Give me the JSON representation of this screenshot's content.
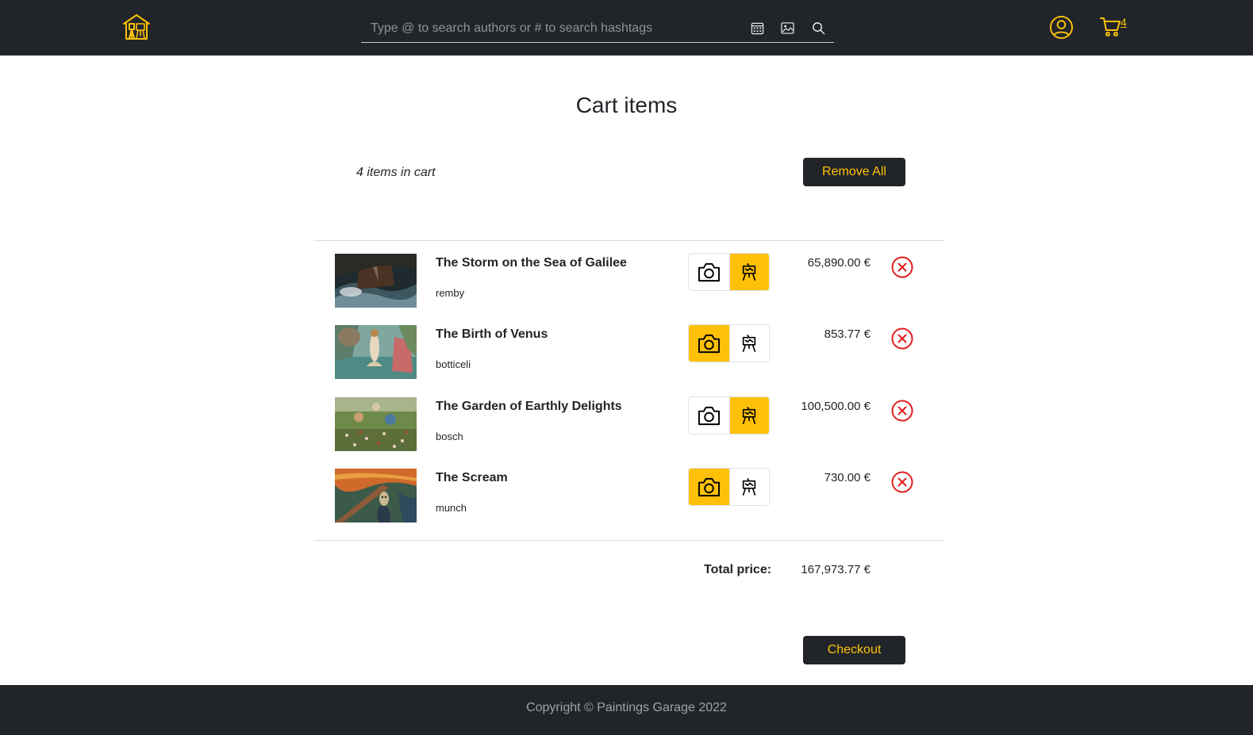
{
  "colors": {
    "navbar": "#212529",
    "accent": "#ffc107",
    "remove": "#e01e1e"
  },
  "header": {
    "logo_icon": "house-with-easel-icon",
    "search_placeholder": "Type @ to search authors or # to search hashtags",
    "search_buttons": [
      "calendar-icon",
      "image-icon",
      "search-icon"
    ],
    "user_icon": "user-circle-icon",
    "cart_icon": "cart-icon",
    "cart_count": "4"
  },
  "main": {
    "title": "Cart items",
    "items_count_text": "4 items in cart",
    "remove_all_label": "Remove All",
    "items": [
      {
        "title": "The Storm on the Sea of Galilee",
        "author": "remby",
        "price": "65,890.00 €",
        "selected_format": "canvas"
      },
      {
        "title": "The Birth of Venus",
        "author": "botticeli",
        "price": "853.77 €",
        "selected_format": "photo"
      },
      {
        "title": "The Garden of Earthly Delights",
        "author": "bosch",
        "price": "100,500.00 €",
        "selected_format": "canvas"
      },
      {
        "title": "The Scream",
        "author": "munch",
        "price": "730.00 €",
        "selected_format": "photo"
      }
    ],
    "format_icons": {
      "photo": "camera-icon",
      "canvas": "easel-icon"
    },
    "total_label": "Total price:",
    "total_value": "167,973.77 €",
    "checkout_label": "Checkout"
  },
  "footer": {
    "text": "Copyright © Paintings Garage 2022"
  }
}
